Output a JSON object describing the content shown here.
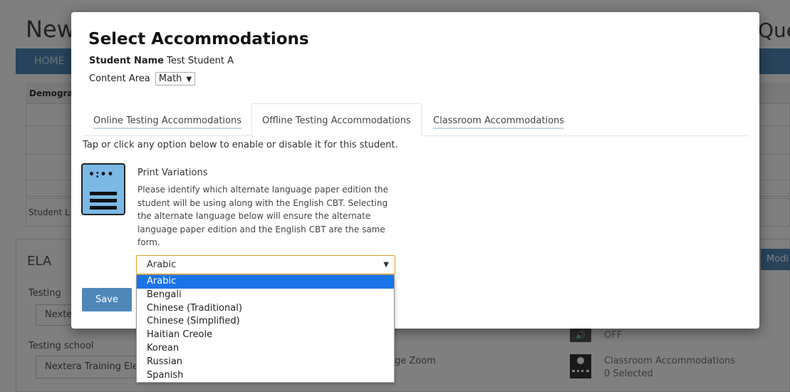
{
  "background": {
    "title": "New",
    "title_right": "Ques",
    "nav_home": "HOME",
    "demographics": "Demogra",
    "student_l": "Student L",
    "ela": "ELA",
    "modify_button": "Modi",
    "testing_label": "Testing",
    "testing_value": "Nexte",
    "testing_school_label": "Testing school",
    "testing_school_value": "Nextera Training Ele",
    "zoom_text": "ge Zoom",
    "audio_status": "OFF",
    "classroom_title": "Classroom Accommodations",
    "classroom_selected": "0 Selected"
  },
  "modal": {
    "title": "Select Accommodations",
    "student_name_label": "Student Name",
    "student_name_value": "Test Student A",
    "content_area_label": "Content Area",
    "content_area_value": "Math",
    "tabs": [
      {
        "label": "Online Testing Accommodations",
        "active": false
      },
      {
        "label": "Offline Testing Accommodations",
        "active": true
      },
      {
        "label": "Classroom Accommodations",
        "active": false
      }
    ],
    "instructions": "Tap or click any option below to enable or disable it for this student.",
    "print_variations": {
      "title": "Print Variations",
      "description": "Please identify which alternate language paper edition the student will be using along with the English CBT. Selecting the alternate language below will ensure the alternate language paper edition and the English CBT are the same form.",
      "icon": "document-print-icon"
    },
    "language_select_value": "Arabic",
    "save_label": "Save",
    "language_options": [
      "Arabic",
      "Bengali",
      "Chinese (Traditional)",
      "Chinese (Simplified)",
      "Haitian Creole",
      "Korean",
      "Russian",
      "Spanish"
    ],
    "selected_option": "Arabic"
  },
  "colors": {
    "accent": "#4e88b9",
    "dropdown_highlight": "#1a73e8",
    "select_focus_border": "#e0a020",
    "icon_fill": "#7ab8e6"
  }
}
